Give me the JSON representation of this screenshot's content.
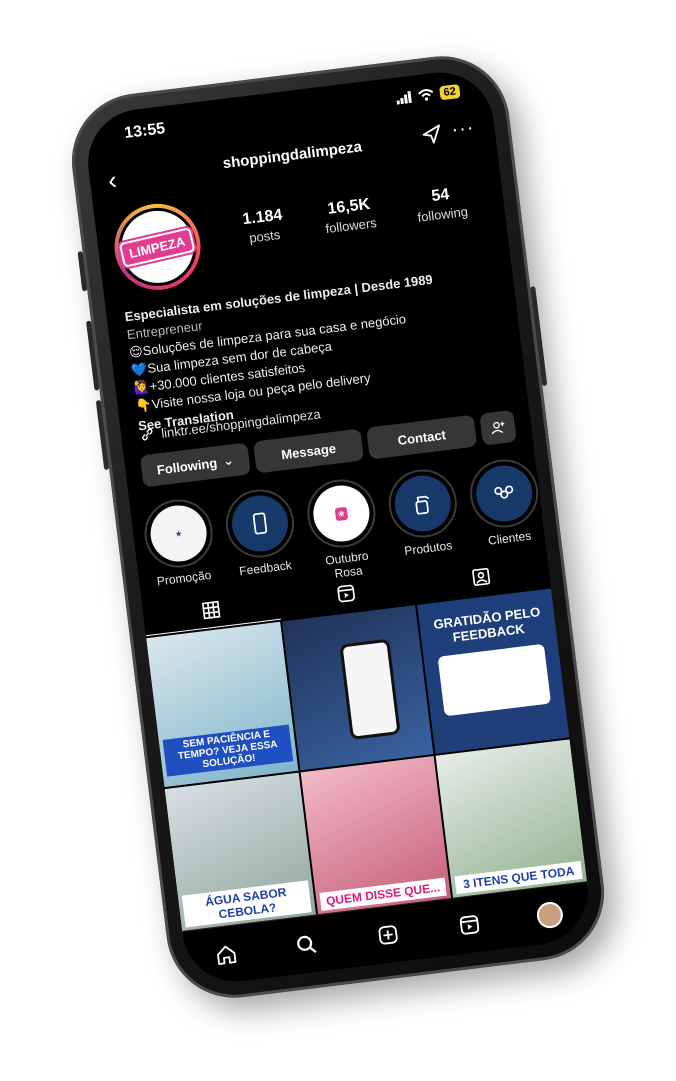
{
  "status": {
    "time": "13:55",
    "battery": "62"
  },
  "header": {
    "username": "shoppingdalimpeza"
  },
  "profile": {
    "logo_text": "LIMPEZA",
    "stats": [
      {
        "num": "1.184",
        "label": "posts"
      },
      {
        "num": "16,5K",
        "label": "followers"
      },
      {
        "num": "54",
        "label": "following"
      }
    ]
  },
  "bio": {
    "name": "Especialista em soluções de limpeza | Desde 1989",
    "category": "Entrepreneur",
    "line1": "😌Soluções de limpeza para sua casa e negócio",
    "line2": "💙Sua limpeza sem dor de cabeça",
    "line3": "🙋‍♀️+30.000 clientes satisfeitos",
    "line4": "👇Visite nossa loja ou peça pelo delivery",
    "see_translation": "See Translation"
  },
  "link": "linktr.ee/shoppingdalimpeza",
  "buttons": {
    "following": "Following",
    "message": "Message",
    "contact": "Contact"
  },
  "highlights": [
    {
      "label": "Promoção"
    },
    {
      "label": "Feedback"
    },
    {
      "label": "Outubro Rosa"
    },
    {
      "label": "Produtos"
    },
    {
      "label": "Clientes"
    }
  ],
  "grid": {
    "p1_caption": "SEM PACIÊNCIA E TEMPO? VEJA ESSA SOLUÇÃO!",
    "p3_caption": "GRATIDÃO PELO FEEDBACK",
    "p4_caption": "ÁGUA SABOR CEBOLA?",
    "p5_caption": "QUEM DISSE QUE...",
    "p6_caption": "3 ITENS QUE TODA"
  },
  "colors": {
    "accent": "#e03c92",
    "background": "#000000",
    "button": "#363636"
  }
}
